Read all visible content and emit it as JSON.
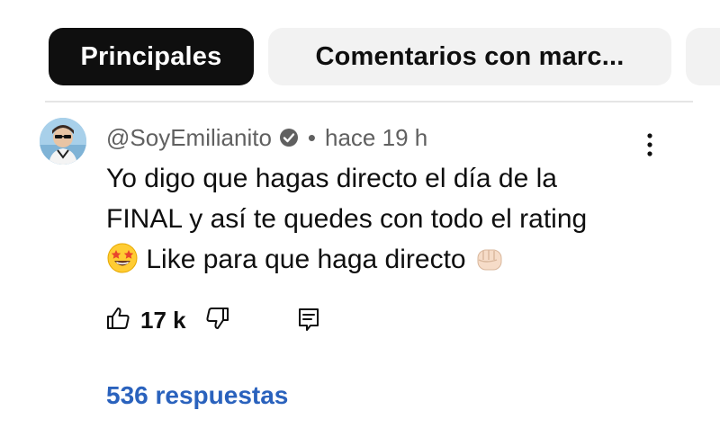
{
  "tabs": [
    {
      "label": "Principales",
      "active": true
    },
    {
      "label": "Comentarios con marc...",
      "active": false
    }
  ],
  "comment": {
    "username": "@SoyEmilianito",
    "separator": "•",
    "time": "hace 19 h",
    "verified": true,
    "lines": [
      "Yo digo que hagas directo el día de la",
      "FINAL y así te quedes con todo el rating",
      "Like para que haga directo"
    ],
    "emojis": [
      "star-struck-emoji",
      "fist-emoji"
    ]
  },
  "actions": {
    "like_count": "17 k",
    "icons": [
      "thumbs-up-icon",
      "thumbs-down-icon",
      "reply-icon"
    ]
  },
  "replies_label": "536 respuestas",
  "colors": {
    "active_chip": "#0f0f0f",
    "inactive_chip": "#f2f2f2",
    "link_blue": "#2a62bd",
    "meta_gray": "#606060"
  }
}
